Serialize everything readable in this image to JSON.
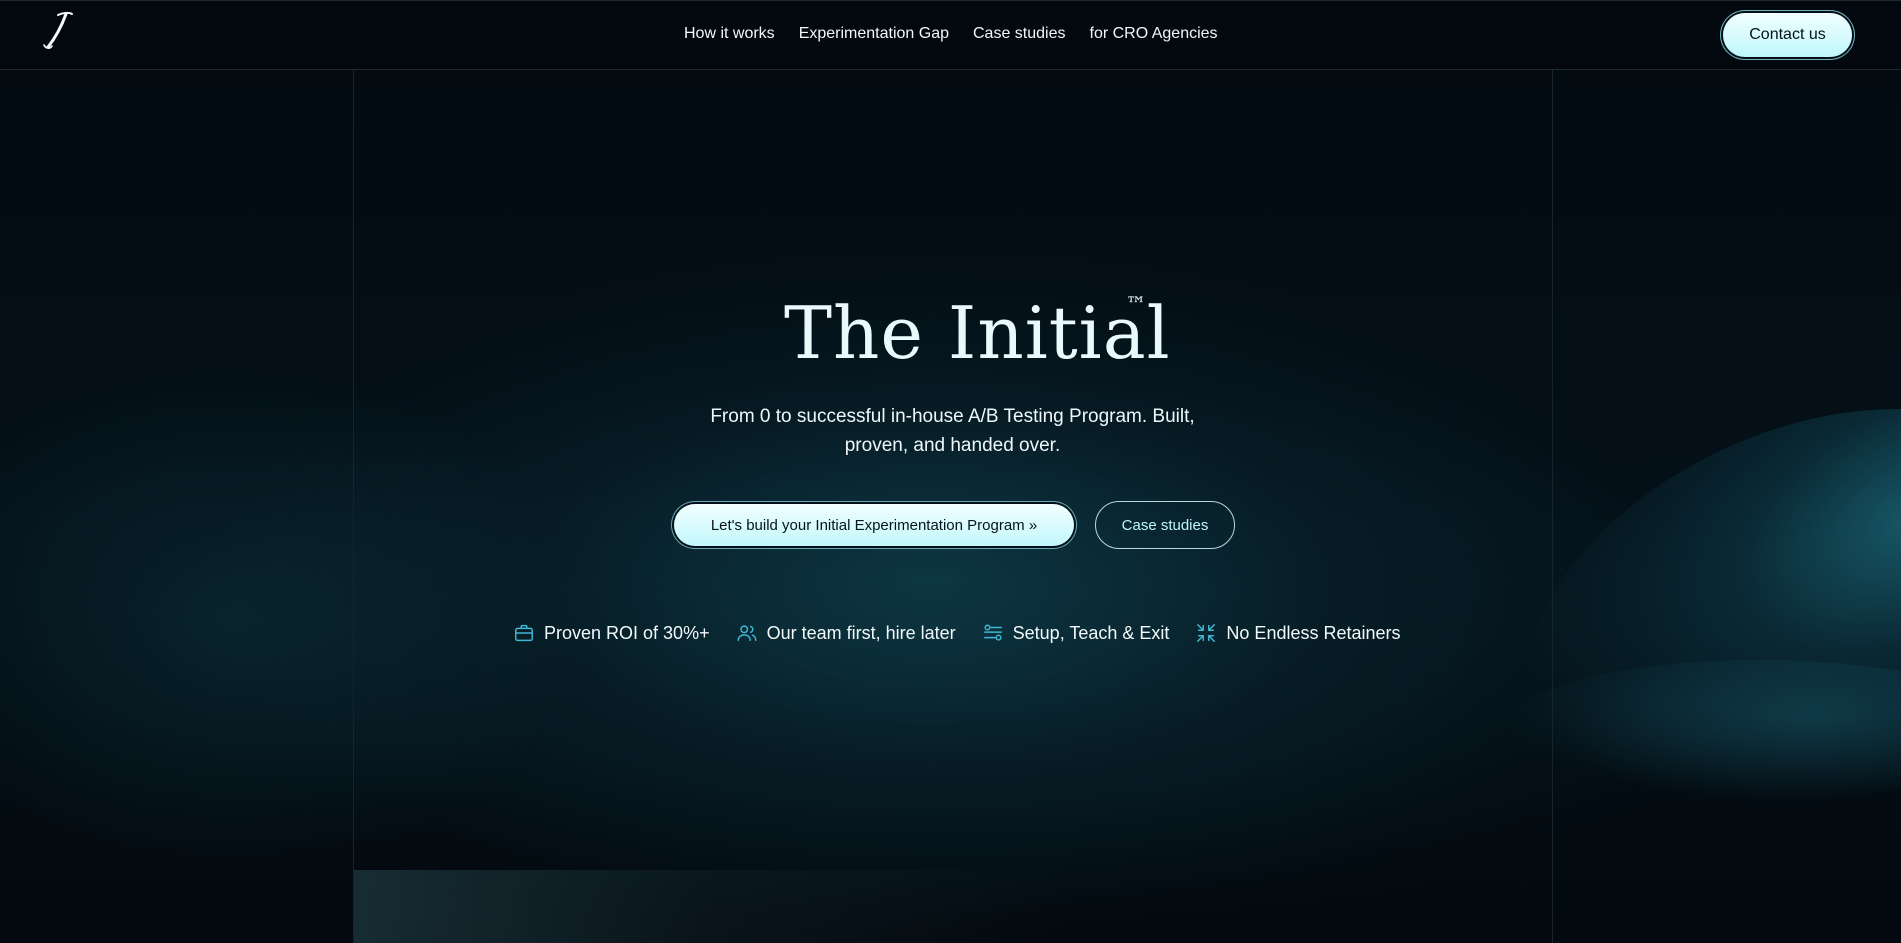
{
  "header": {
    "logo_icon": "script-i-logo-icon",
    "nav": [
      {
        "label": "How it works"
      },
      {
        "label": "Experimentation Gap"
      },
      {
        "label": "Case studies"
      },
      {
        "label": "for CRO Agencies"
      }
    ],
    "contact_label": "Contact us"
  },
  "hero": {
    "title": "The Initial",
    "trademark": "™",
    "subtitle": "From 0 to successful in-house A/B Testing Program. Built, proven, and handed over.",
    "primary_cta": "Let's build your Initial Experimentation Program »",
    "secondary_cta": "Case studies"
  },
  "features": [
    {
      "icon": "briefcase-icon",
      "label": "Proven ROI of 30%+"
    },
    {
      "icon": "users-icon",
      "label": "Our team first, hire later"
    },
    {
      "icon": "toggles-icon",
      "label": "Setup, Teach & Exit"
    },
    {
      "icon": "shrink-arrows-icon",
      "label": "No Endless Retainers"
    }
  ],
  "colors": {
    "background": "#030a10",
    "accent": "#bff7fb",
    "icon_accent": "#3fb6d2",
    "text": "#eef8fa"
  }
}
